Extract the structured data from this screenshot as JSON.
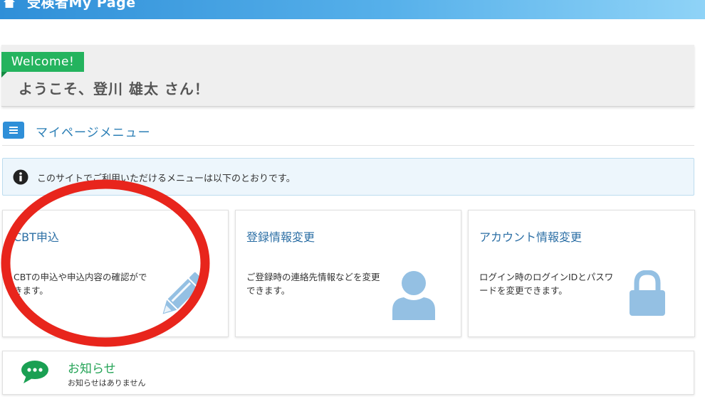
{
  "header": {
    "title": "受検者My Page"
  },
  "welcome": {
    "badge": "Welcome!",
    "greeting": "ようこそ、登川 雄太 さん！"
  },
  "menu": {
    "title": "マイページメニュー"
  },
  "info": {
    "text": "このサイトでご利用いただけるメニューは以下のとおりです。"
  },
  "cards": [
    {
      "title": "CBT申込",
      "desc": "CBTの申込や申込内容の確認ができます。",
      "icon": "pencil-icon"
    },
    {
      "title": "登録情報変更",
      "desc": "ご登録時の連絡先情報などを変更できます。",
      "icon": "user-icon"
    },
    {
      "title": "アカウント情報変更",
      "desc": "ログイン時のログインIDとパスワードを変更できます。",
      "icon": "lock-icon"
    }
  ],
  "notice": {
    "title": "お知らせ",
    "text": "お知らせはありません"
  },
  "colors": {
    "header_start": "#2f8fd8",
    "welcome_green": "#24b35e",
    "link_blue": "#2c6fa5",
    "icon_blue": "#94c0e3",
    "annotation_red": "#e8251c"
  }
}
